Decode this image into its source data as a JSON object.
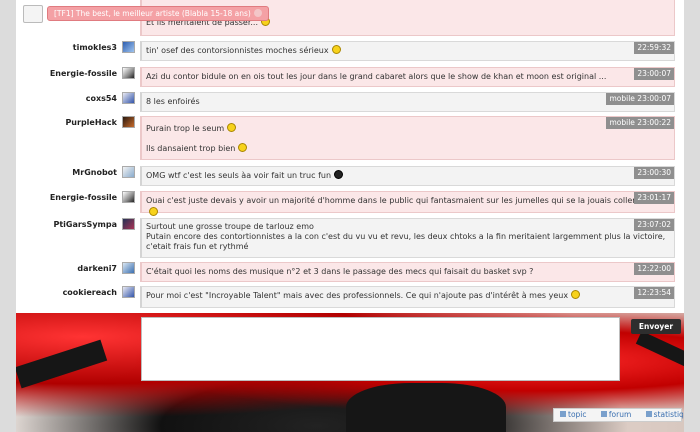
{
  "tooltip": {
    "text": "[TF1] The best, le meilleur artiste (Blabla 15-18 ans)"
  },
  "rows": [
    {
      "user": "",
      "lines": [
        "Et ils méritaient de passer..."
      ],
      "time": "",
      "pink": true
    },
    {
      "user": "timokles3",
      "lines": [
        "tin' osef des contorsionnistes moches sérieux"
      ],
      "time": "22:59:32",
      "pink": false
    },
    {
      "user": "Energie-fossile",
      "lines": [
        "Azi du contor bidule on en ois tout les jour dans le grand cabaret alors que le show de khan et moon est original ..."
      ],
      "time": "23:00:07",
      "pink": true
    },
    {
      "user": "coxs54",
      "lines": [
        "8 les enfoirés"
      ],
      "time": "mobile 23:00:07",
      "pink": false
    },
    {
      "user": "PurpleHack",
      "lines": [
        "Purain trop le seum",
        "",
        "Ils dansaient trop bien"
      ],
      "time": "mobile 23:00:22",
      "pink": true
    },
    {
      "user": "MrGnobot",
      "lines": [
        "OMG wtf c'est les seuls àa voir fait un truc fun"
      ],
      "time": "23:00:30",
      "pink": false
    },
    {
      "user": "Energie-fossile",
      "lines": [
        "Ouai c'est juste devais y avoir un majorité d'homme dans le public qui fantasmaient sur les jumelles qui se la jouais coller serrer"
      ],
      "time": "23:01:17",
      "pink": true
    },
    {
      "user": "PtiGarsSympa",
      "lines": [
        "Surtout une grosse troupe de tarlouz emo",
        "Putain encore des contortionnistes a la con c'est du vu vu et revu, les deux chtoks a la fin meritaient largemment plus la victoire, c'etait frais fun et rythmé"
      ],
      "time": "23:07:02",
      "pink": false
    },
    {
      "user": "darkeni7",
      "lines": [
        "C'était quoi les noms des musique n°2 et 3 dans le passage des mecs qui faisait du basket svp ?"
      ],
      "time": "12:22:00",
      "pink": true
    },
    {
      "user": "cookiereach",
      "lines": [
        "Pour moi c'est \"Incroyable Talent\" mais avec des professionnels. Ce qui n'ajoute pas d'intérêt à mes yeux"
      ],
      "time": "12:23:54",
      "pink": false
    }
  ],
  "composer": {
    "send_label": "Envoyer"
  },
  "footer_links": {
    "topic": "topic",
    "forum": "forum",
    "stats": "statistiques"
  },
  "colors": {
    "pink_bg": "#fbe7e8",
    "timestamp_bg": "#8f8f8f",
    "tooltip_bg": "#f4a1a5",
    "send_bg": "#2e2e2e"
  }
}
